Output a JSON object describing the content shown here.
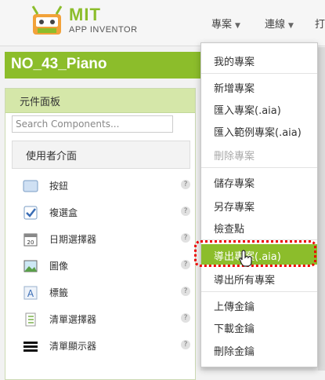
{
  "header": {
    "brand_title": "MIT",
    "brand_subtitle": "APP INVENTOR",
    "nav": [
      {
        "label": "專案"
      },
      {
        "label": "連線"
      },
      {
        "label": "打"
      }
    ]
  },
  "project": {
    "name": "NO_43_Piano"
  },
  "palette": {
    "title": "元件面板",
    "search_placeholder": "Search Components...",
    "category": "使用者介面",
    "components": [
      {
        "label": "按鈕",
        "icon": "button-icon"
      },
      {
        "label": "複選盒",
        "icon": "checkbox-icon"
      },
      {
        "label": "日期選擇器",
        "icon": "date-picker-icon"
      },
      {
        "label": "圖像",
        "icon": "image-icon"
      },
      {
        "label": "標籤",
        "icon": "label-icon"
      },
      {
        "label": "清單選擇器",
        "icon": "list-picker-icon"
      },
      {
        "label": "清單顯示器",
        "icon": "list-view-icon"
      }
    ],
    "help_glyph": "?"
  },
  "menu": {
    "items": [
      {
        "label": "我的專案"
      },
      {
        "label": "新增專案"
      },
      {
        "label": "匯入專案(.aia)"
      },
      {
        "label": "匯入範例專案(.aia)"
      },
      {
        "label": "刪除專案",
        "disabled": true
      },
      {
        "label": "儲存專案"
      },
      {
        "label": "另存專案"
      },
      {
        "label": "檢查點"
      },
      {
        "label": "導出專案(.aia)",
        "highlighted": true
      },
      {
        "label": "導出所有專案"
      },
      {
        "label": "上傳金鑰"
      },
      {
        "label": "下載金鑰"
      },
      {
        "label": "刪除金鑰"
      }
    ]
  },
  "colors": {
    "accent": "#8cbd2b",
    "highlight_outline": "#e00000"
  }
}
